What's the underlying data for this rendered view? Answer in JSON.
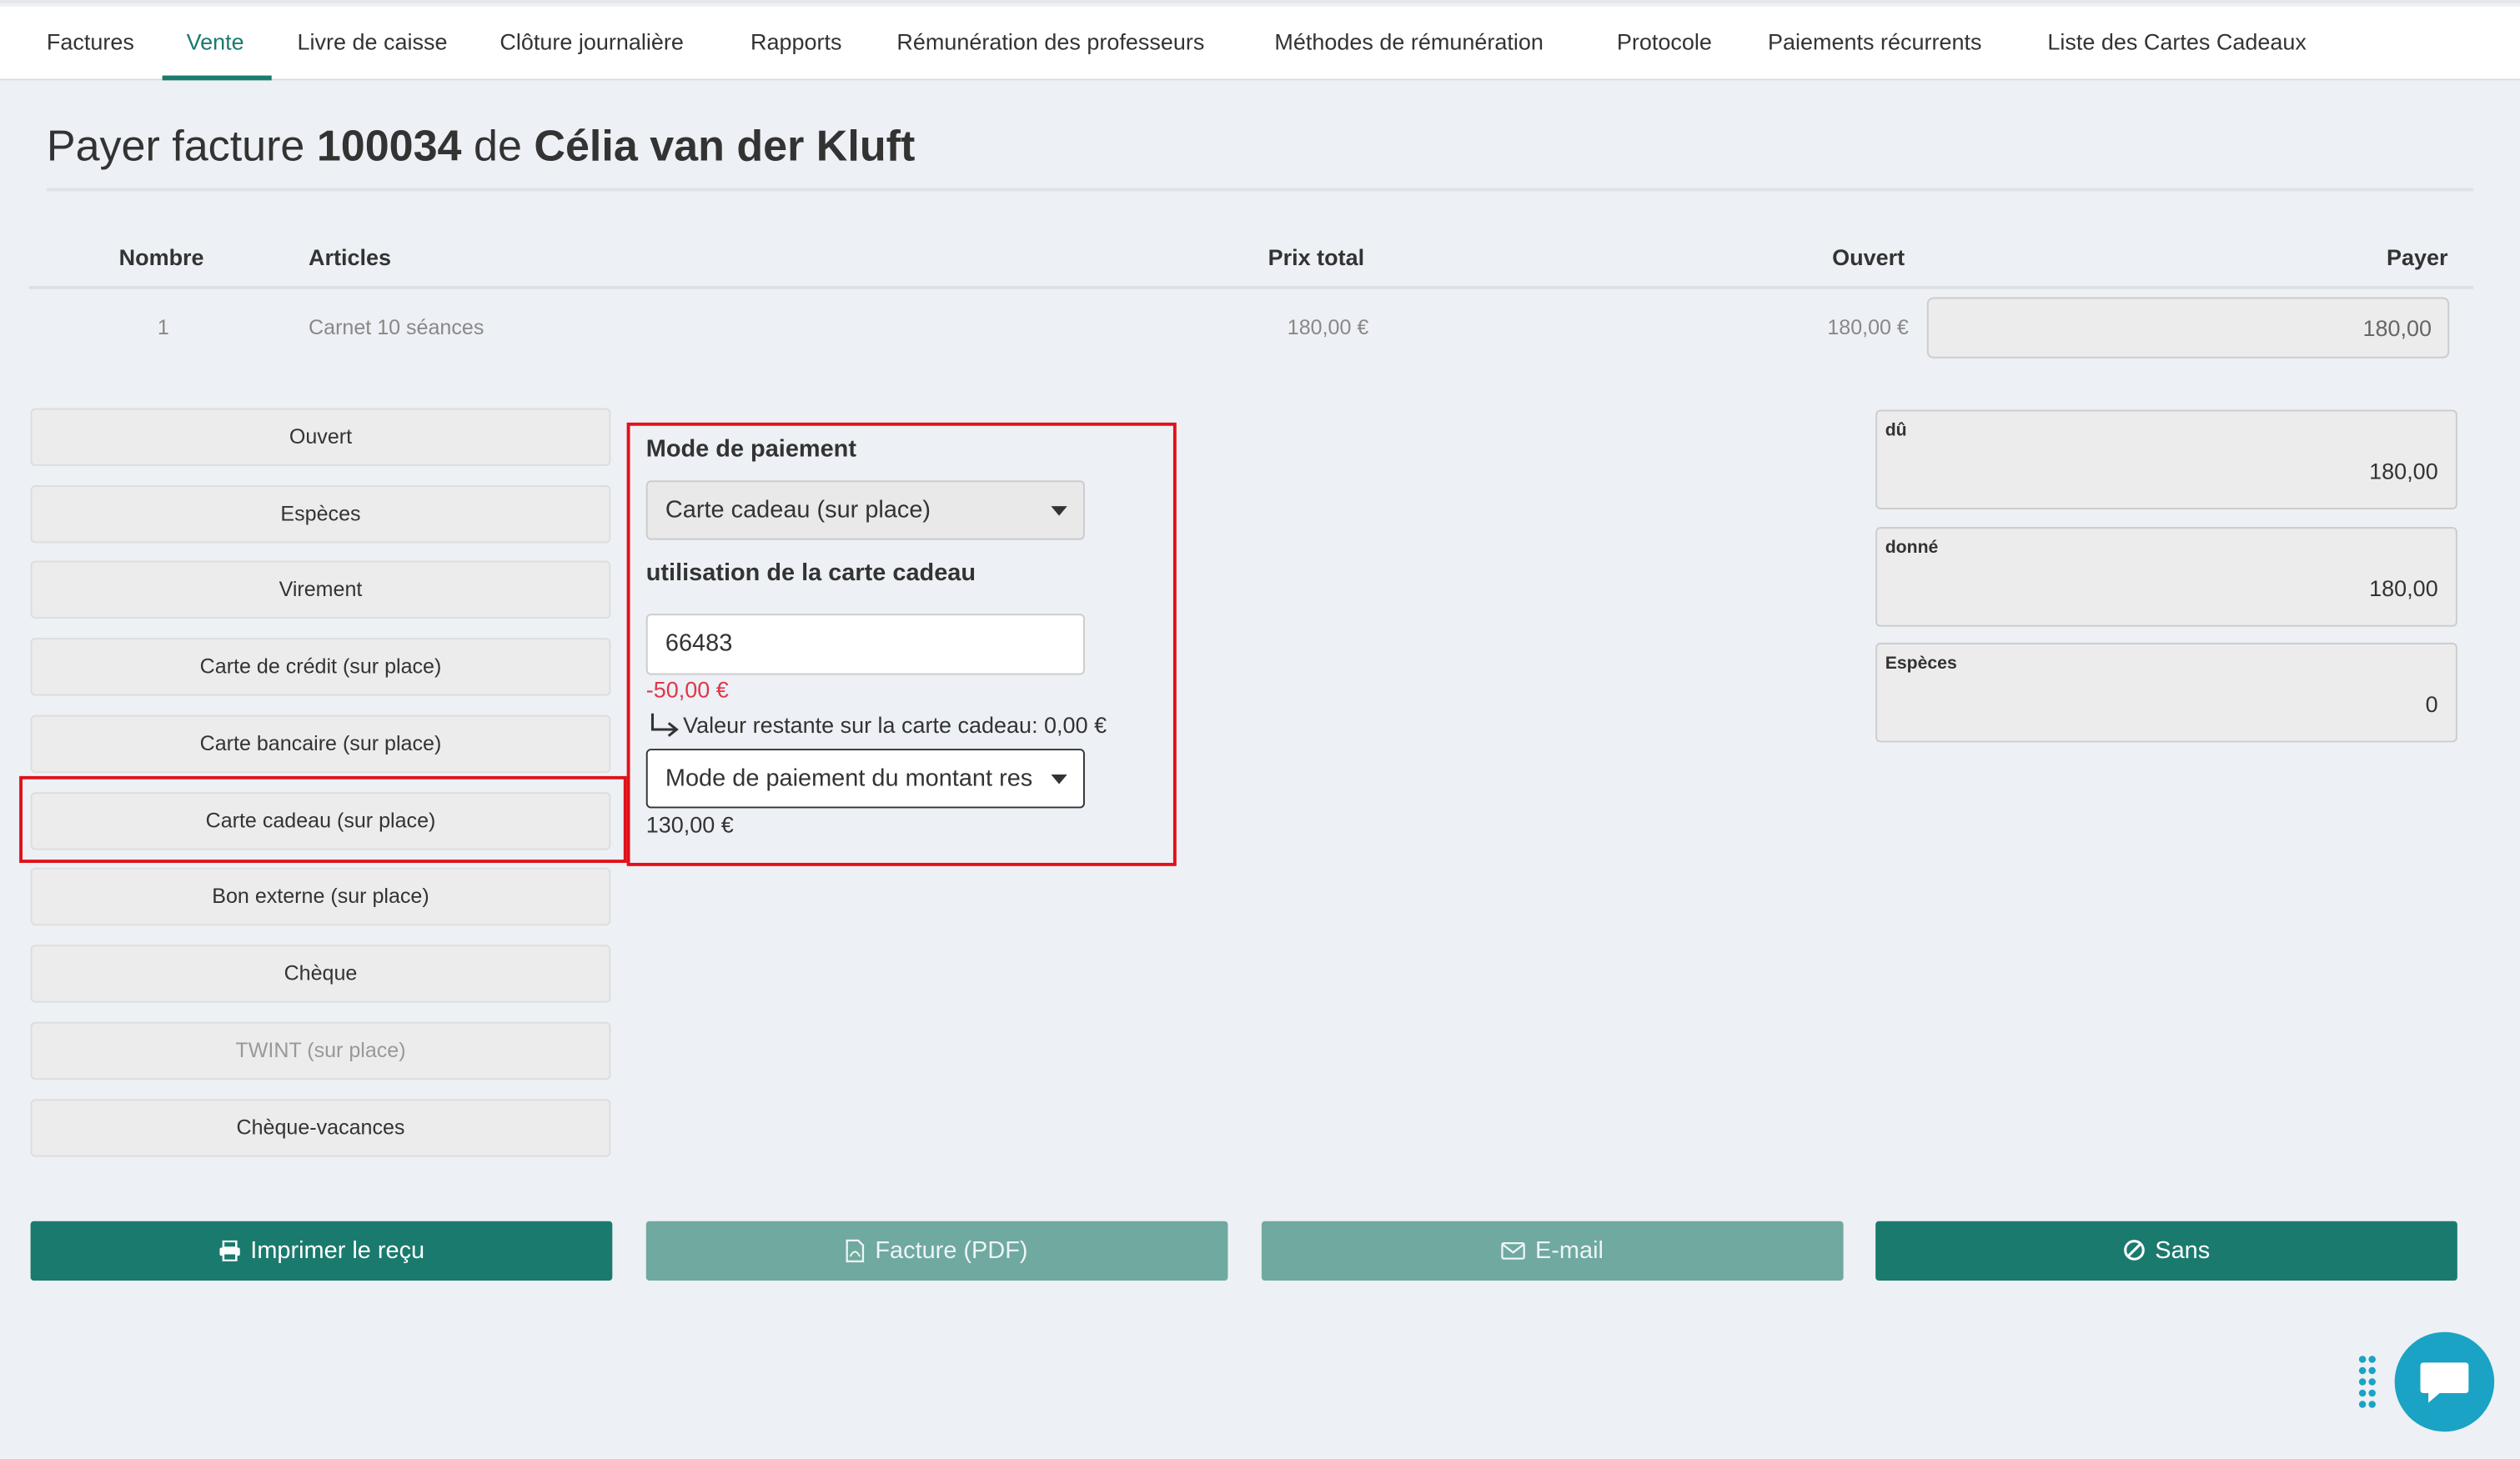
{
  "nav": {
    "items": [
      "Factures",
      "Vente",
      "Livre de caisse",
      "Clôture journalière",
      "Rapports",
      "Rémunération des professeurs",
      "Méthodes de rémunération",
      "Protocole",
      "Paiements récurrents",
      "Liste des Cartes Cadeaux"
    ],
    "active": "Vente"
  },
  "title": {
    "prefix": "Payer facture",
    "invoice_number": "100034",
    "of": "de",
    "customer": "Célia van der Kluft"
  },
  "table": {
    "headers": [
      "Nombre",
      "Articles",
      "Prix total",
      "Ouvert",
      "Payer"
    ],
    "rows": [
      {
        "nombre": "1",
        "article": "Carnet 10 séances",
        "prix_total": "180,00 €",
        "ouvert": "180,00 €",
        "payer": "180,00"
      }
    ]
  },
  "methods": [
    "Ouvert",
    "Espèces",
    "Virement",
    "Carte de crédit (sur place)",
    "Carte bancaire (sur place)",
    "Carte cadeau (sur place)",
    "Bon externe (sur place)",
    "Chèque",
    "TWINT (sur place)",
    "Chèque-vacances"
  ],
  "selected_method": "Carte cadeau (sur place)",
  "disabled_method": "TWINT (sur place)",
  "panel": {
    "mode_label": "Mode de paiement",
    "mode_value": "Carte cadeau (sur place)",
    "giftcard_label": "utilisation de la carte cadeau",
    "giftcard_code": "66483",
    "deduction": "-50,00 €",
    "remaining_text": "Valeur restante sur la carte cadeau: 0,00 €",
    "remaining_mode_placeholder": "Mode de paiement du montant res",
    "remaining_amount": "130,00 €"
  },
  "summary": {
    "due_label": "dû",
    "due_value": "180,00",
    "given_label": "donné",
    "given_value": "180,00",
    "cash_label": "Espèces",
    "cash_value": "0"
  },
  "actions": {
    "print": "Imprimer le reçu",
    "pdf": "Facture (PDF)",
    "email": "E-mail",
    "none": "Sans"
  },
  "colors": {
    "accent": "#1a7a6e",
    "accent_light": "#6fa9a0",
    "highlight": "#e0101a",
    "negative": "#e0354a",
    "chat": "#1aa3c4"
  },
  "icons": [
    "printer-icon",
    "pdf-file-icon",
    "envelope-icon",
    "ban-icon",
    "chat-icon",
    "drag-dots-icon",
    "caret-down-icon",
    "return-arrow-icon"
  ]
}
